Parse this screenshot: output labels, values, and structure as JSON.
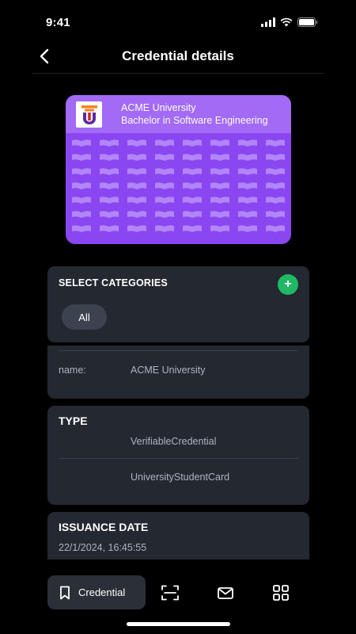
{
  "status_bar": {
    "time": "9:41"
  },
  "nav": {
    "title": "Credential details"
  },
  "card": {
    "organization": "ACME University",
    "degree": "Bachelor in Software Engineering",
    "colors": {
      "header": "#a26af5",
      "body": "#8a46f0",
      "pattern": "#b285f8"
    }
  },
  "categories": {
    "title": "SELECT CATEGORIES",
    "add_label": "+",
    "chips": [
      "All"
    ]
  },
  "issuer": {
    "name_label": "name:",
    "name_value": "ACME University"
  },
  "type": {
    "title": "TYPE",
    "values": [
      "VerifiableCredential",
      "UniversityStudentCard"
    ]
  },
  "issuance": {
    "title": "ISSUANCE DATE",
    "value": "22/1/2024, 16:45:55"
  },
  "tab_bar": {
    "active_label": "Credential",
    "icons": [
      "bookmark-icon",
      "scan-icon",
      "mail-icon",
      "grid-icon"
    ]
  },
  "colors": {
    "background": "#000000",
    "panel": "#242831",
    "accent_green": "#1fb866"
  }
}
